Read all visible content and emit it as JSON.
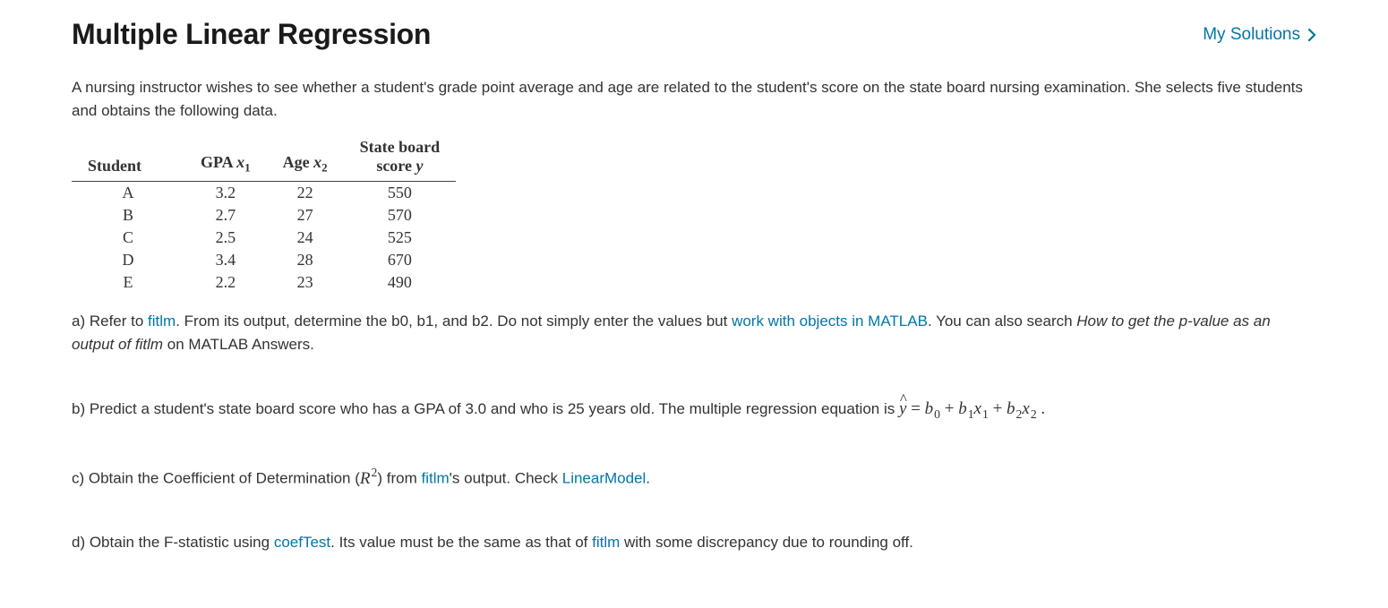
{
  "header": {
    "title": "Multiple Linear Regression",
    "my_solutions": "My Solutions"
  },
  "intro": "A nursing instructor wishes to see whether a student's grade point average and age are related to the student's score on the state board nursing examination. She selects five students and obtains the following data.",
  "table": {
    "headers": {
      "student": "Student",
      "gpa_label": "GPA ",
      "gpa_var": "x",
      "gpa_sub": "1",
      "age_label": "Age ",
      "age_var": "x",
      "age_sub": "2",
      "score_line1": "State board",
      "score_line2_a": "score ",
      "score_line2_var": "y"
    },
    "rows": [
      {
        "student": "A",
        "gpa": "3.2",
        "age": "22",
        "score": "550"
      },
      {
        "student": "B",
        "gpa": "2.7",
        "age": "27",
        "score": "570"
      },
      {
        "student": "C",
        "gpa": "2.5",
        "age": "24",
        "score": "525"
      },
      {
        "student": "D",
        "gpa": "3.4",
        "age": "28",
        "score": "670"
      },
      {
        "student": "E",
        "gpa": "2.2",
        "age": "23",
        "score": "490"
      }
    ]
  },
  "qa": {
    "pre1": "a) Refer to ",
    "link_fitlm": "fitlm",
    "post1a": ". From its output, determine the b0, b1, and b2. Do not simply enter the values but ",
    "link_objects": "work with objects in MATLAB",
    "post1b": ". You can also search ",
    "italic1": "How to get the p-value as an output of fitlm",
    "post1c": " on MATLAB Answers."
  },
  "qb": {
    "text": "b) Predict a student's state board score who has a GPA of 3.0 and who is 25 years old. The multiple regression equation is ",
    "eq_parts": {
      "yhat_y": "y",
      "eq": " = ",
      "b": "b",
      "s0": "0",
      "plus": " + ",
      "s1": "1",
      "x": "x",
      "s2": "2",
      "dot": " ."
    }
  },
  "qc": {
    "pre": "c) Obtain the Coefficient of Determination (",
    "R": "R",
    "two": "2",
    "mid": ") from ",
    "link_fitlm": "fitlm",
    "post_a": "'s output. Check ",
    "link_linmodel": "LinearModel",
    "post_b": "."
  },
  "qd": {
    "pre": "d) Obtain the F-statistic using ",
    "link_coef": "coefTest",
    "mid": ". Its value must be the same as that of ",
    "link_fitlm": "fitlm",
    "post": " with some discrepancy due to rounding off."
  }
}
